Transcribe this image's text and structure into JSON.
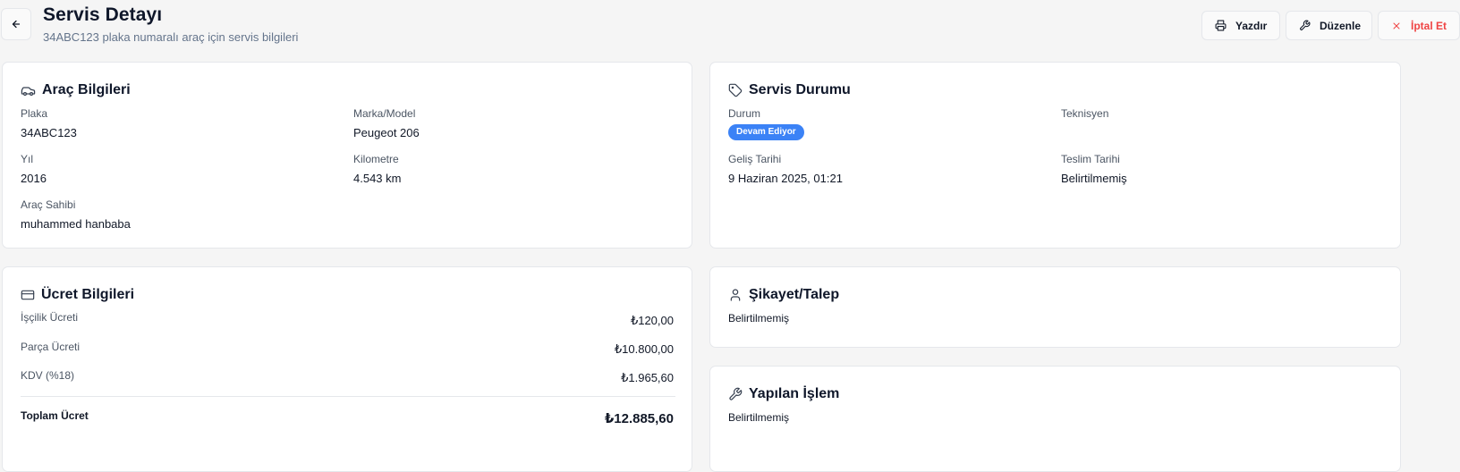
{
  "header": {
    "title": "Servis Detayı",
    "subtitle": "34ABC123 plaka numaralı araç için servis bilgileri",
    "actions": {
      "print": "Yazdır",
      "edit": "Düzenle",
      "cancel": "İptal Et"
    }
  },
  "vehicle": {
    "title": "Araç Bilgileri",
    "plate_label": "Plaka",
    "plate": "34ABC123",
    "model_label": "Marka/Model",
    "model": "Peugeot 206",
    "year_label": "Yıl",
    "year": "2016",
    "km_label": "Kilometre",
    "km": "4.543 km",
    "owner_label": "Araç Sahibi",
    "owner": "muhammed hanbaba"
  },
  "status": {
    "title": "Servis Durumu",
    "state_label": "Durum",
    "state": "Devam Ediyor",
    "tech_label": "Teknisyen",
    "tech": "",
    "arrival_label": "Geliş Tarihi",
    "arrival": "9 Haziran 2025, 01:21",
    "delivery_label": "Teslim Tarihi",
    "delivery": "Belirtilmemiş"
  },
  "fees": {
    "title": "Ücret Bilgileri",
    "labor_label": "İşçilik Ücreti",
    "labor": "₺120,00",
    "parts_label": "Parça Ücreti",
    "parts": "₺10.800,00",
    "vat_label": "KDV (%18)",
    "vat": "₺1.965,60",
    "total_label": "Toplam Ücret",
    "total": "₺12.885,60"
  },
  "complaint": {
    "title": "Şikayet/Talep",
    "value": "Belirtilmemiş"
  },
  "work": {
    "title": "Yapılan İşlem",
    "value": "Belirtilmemiş"
  },
  "colors": {
    "accent": "#3b82f6",
    "danger": "#ef4444",
    "background": "#f5f5f5"
  }
}
